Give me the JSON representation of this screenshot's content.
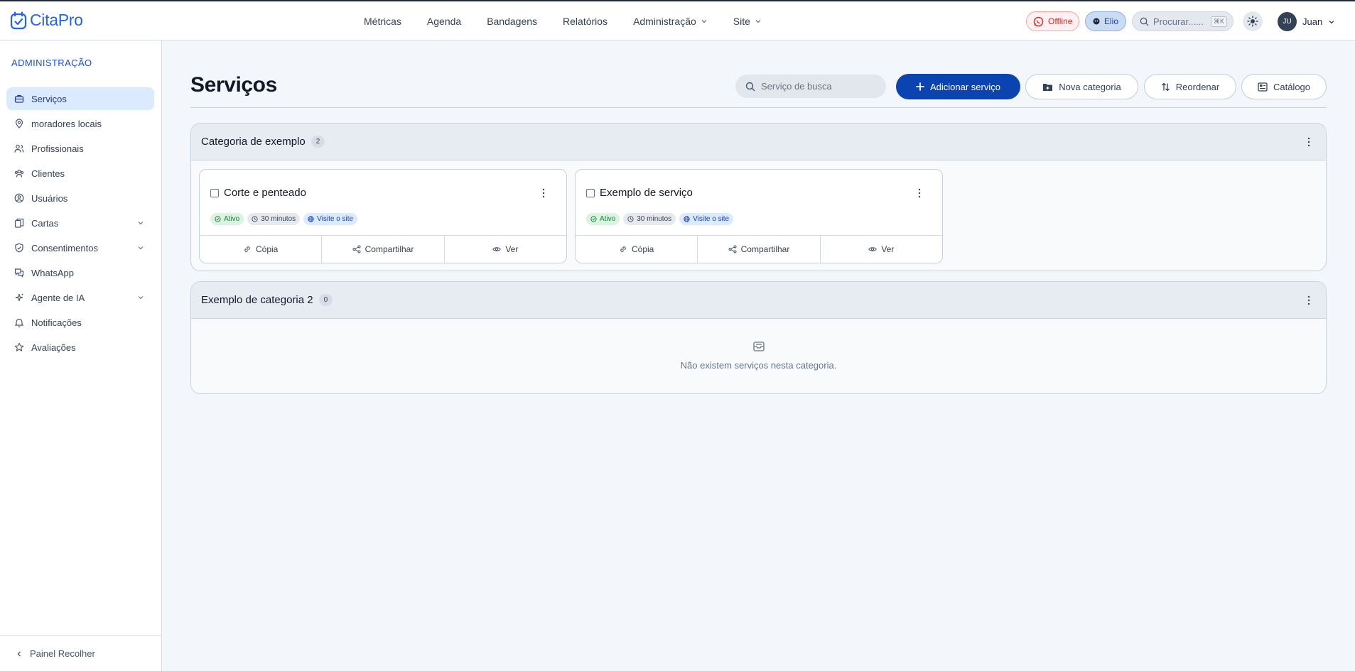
{
  "app": {
    "name": "CitaPro"
  },
  "topnav": [
    {
      "label": "Métricas"
    },
    {
      "label": "Agenda"
    },
    {
      "label": "Bandagens"
    },
    {
      "label": "Relatórios"
    },
    {
      "label": "Administração"
    },
    {
      "label": "Site"
    }
  ],
  "topbar": {
    "offline_label": "Offline",
    "elio_label": "Elio",
    "search_placeholder": "Procurar......",
    "search_shortcut": "⌘K",
    "user_initials": "JU",
    "user_name": "Juan"
  },
  "sidebar": {
    "title": "ADMINISTRAÇÃO",
    "items": [
      {
        "label": "Serviços",
        "active": true
      },
      {
        "label": "moradores locais"
      },
      {
        "label": "Profissionais"
      },
      {
        "label": "Clientes"
      },
      {
        "label": "Usuários"
      },
      {
        "label": "Cartas",
        "expandable": true
      },
      {
        "label": "Consentimentos",
        "expandable": true
      },
      {
        "label": "WhatsApp"
      },
      {
        "label": "Agente de IA",
        "expandable": true
      },
      {
        "label": "Notificações"
      },
      {
        "label": "Avaliações"
      }
    ],
    "collapse_label": "Painel Recolher"
  },
  "main": {
    "title": "Serviços",
    "search_placeholder": "Serviço de busca",
    "add_service_label": "Adicionar serviço",
    "new_category_label": "Nova categoria",
    "reorder_label": "Reordenar",
    "catalog_label": "Catálogo"
  },
  "categories": [
    {
      "name": "Categoria de exemplo",
      "count": "2",
      "services": [
        {
          "name": "Corte e penteado",
          "status": "Ativo",
          "duration": "30 minutos",
          "site_link": "Visite o site"
        },
        {
          "name": "Exemplo de serviço",
          "status": "Ativo",
          "duration": "30 minutos",
          "site_link": "Visite o site"
        }
      ]
    },
    {
      "name": "Exemplo de categoria 2",
      "count": "0",
      "empty_text": "Não existem serviços nesta categoria."
    }
  ],
  "card_actions": {
    "copy": "Cópia",
    "share": "Compartilhar",
    "view": "Ver"
  },
  "colors": {
    "primary": "#0b44b1",
    "brand": "#2563eb",
    "active_bg": "#dbeafe",
    "offline": "#dc2626",
    "success": "#15803d"
  }
}
